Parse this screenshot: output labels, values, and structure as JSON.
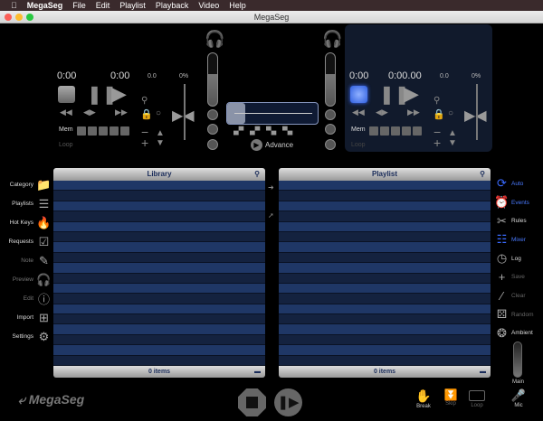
{
  "menubar": {
    "app": "MegaSeg",
    "items": [
      "File",
      "Edit",
      "Playlist",
      "Playback",
      "Video",
      "Help"
    ]
  },
  "window": {
    "title": "MegaSeg"
  },
  "deck_left": {
    "elapsed": "0:00",
    "remaining": "0:00",
    "pitch": "0.0",
    "percent": "0%",
    "mem": "Mem",
    "loop": "Loop",
    "active": false
  },
  "deck_right": {
    "elapsed": "0:00",
    "remaining": "0:00.00",
    "pitch": "0.0",
    "percent": "0%",
    "mem": "Mem",
    "loop": "Loop",
    "active": true
  },
  "crossfader": {
    "advance": "Advance"
  },
  "library": {
    "title": "Library",
    "footer": "0 items"
  },
  "playlist": {
    "title": "Playlist",
    "footer": "0 items"
  },
  "left_sidebar": [
    {
      "label": "Category",
      "icon": "folder-icon",
      "enabled": true
    },
    {
      "label": "Playlists",
      "icon": "list-icon",
      "enabled": true
    },
    {
      "label": "Hot Keys",
      "icon": "flame-icon",
      "enabled": true
    },
    {
      "label": "Requests",
      "icon": "clipboard-check-icon",
      "enabled": true
    },
    {
      "label": "Note",
      "icon": "pencil-icon",
      "enabled": false
    },
    {
      "label": "Preview",
      "icon": "headphones-icon",
      "enabled": false
    },
    {
      "label": "Edit",
      "icon": "info-icon",
      "enabled": false
    },
    {
      "label": "Import",
      "icon": "import-plus-icon",
      "enabled": true
    },
    {
      "label": "Settings",
      "icon": "gear-icon",
      "enabled": true
    }
  ],
  "right_sidebar": [
    {
      "label": "Auto",
      "icon": "auto-icon",
      "state": "active"
    },
    {
      "label": "Events",
      "icon": "alarm-clock-icon",
      "state": "active"
    },
    {
      "label": "Rules",
      "icon": "rules-icon",
      "state": "normal"
    },
    {
      "label": "Mixer",
      "icon": "mixer-icon",
      "state": "active"
    },
    {
      "label": "Log",
      "icon": "clock-icon",
      "state": "normal"
    },
    {
      "label": "Save",
      "icon": "plus-icon",
      "state": "disabled"
    },
    {
      "label": "Clear",
      "icon": "broom-icon",
      "state": "disabled"
    },
    {
      "label": "Random",
      "icon": "dice-icon",
      "state": "disabled"
    },
    {
      "label": "Ambient",
      "icon": "ambient-icon",
      "state": "normal"
    }
  ],
  "main_volume": {
    "label": "Main"
  },
  "bottom": {
    "logo": "MegaSeg",
    "break": "Break",
    "skip": "Skip",
    "loop": "Loop",
    "mic": "Mic"
  },
  "colors": {
    "accent": "#3a6aff",
    "row_a": "#1f3766",
    "row_b": "#14223f"
  }
}
